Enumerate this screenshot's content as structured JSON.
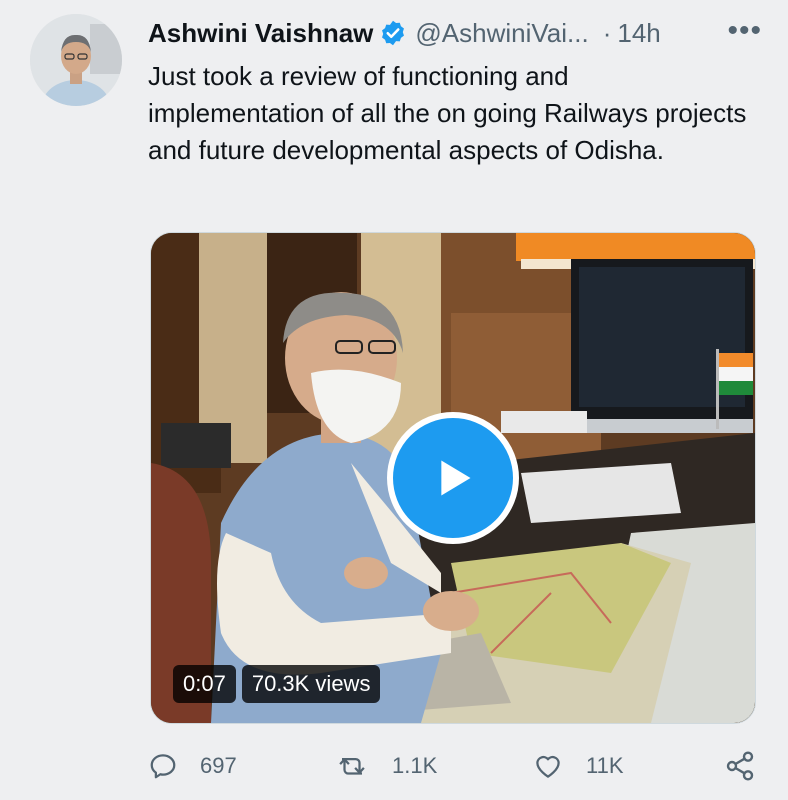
{
  "tweet": {
    "author_name": "Ashwini Vaishnaw",
    "author_handle": "@AshwiniVai...",
    "separator": "·",
    "time": "14h",
    "more_label": "•••",
    "text": "Just took a review of functioning and implementation of all the on going Railways projects and future developmental aspects of Odisha."
  },
  "video": {
    "duration": "0:07",
    "views": "70.3K views"
  },
  "actions": {
    "replies": "697",
    "retweets": "1.1K",
    "likes": "11K"
  },
  "icons": {
    "verified": "verified-badge-icon",
    "play": "play-icon",
    "reply": "reply-icon",
    "retweet": "retweet-icon",
    "like": "heart-icon",
    "share": "share-icon",
    "more": "more-icon"
  },
  "colors": {
    "accent": "#1d9bf0",
    "muted_text": "#536471",
    "background": "#eeeff1"
  }
}
